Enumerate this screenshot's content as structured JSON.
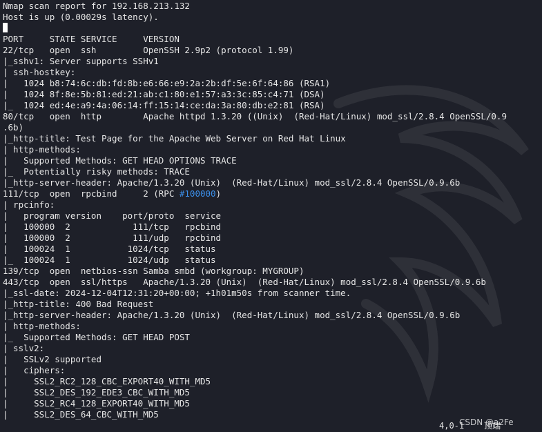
{
  "terminal": {
    "lines": [
      "Nmap scan report for 192.168.213.132",
      "Host is up (0.00029s latency).",
      "",
      "PORT     STATE SERVICE     VERSION",
      "22/tcp   open  ssh         OpenSSH 2.9p2 (protocol 1.99)",
      "|_sshv1: Server supports SSHv1",
      "| ssh-hostkey:",
      "|   1024 b8:74:6c:db:fd:8b:e6:66:e9:2a:2b:df:5e:6f:64:86 (RSA1)",
      "|   1024 8f:8e:5b:81:ed:21:ab:c1:80:e1:57:a3:3c:85:c4:71 (DSA)",
      "|_  1024 ed:4e:a9:4a:06:14:ff:15:14:ce:da:3a:80:db:e2:81 (RSA)",
      "80/tcp   open  http        Apache httpd 1.3.20 ((Unix)  (Red-Hat/Linux) mod_ssl/2.8.4 OpenSSL/0.9",
      ".6b)",
      "|_http-title: Test Page for the Apache Web Server on Red Hat Linux",
      "| http-methods:",
      "|   Supported Methods: GET HEAD OPTIONS TRACE",
      "|_  Potentially risky methods: TRACE",
      "|_http-server-header: Apache/1.3.20 (Unix)  (Red-Hat/Linux) mod_ssl/2.8.4 OpenSSL/0.9.6b",
      "111/tcp  open  rpcbind     2 (RPC ",
      "| rpcinfo:",
      "|   program version    port/proto  service",
      "|   100000  2            111/tcp   rpcbind",
      "|   100000  2            111/udp   rpcbind",
      "|   100024  1           1024/tcp   status",
      "|_  100024  1           1024/udp   status",
      "139/tcp  open  netbios-ssn Samba smbd (workgroup: MYGROUP)",
      "443/tcp  open  ssl/https   Apache/1.3.20 (Unix)  (Red-Hat/Linux) mod_ssl/2.8.4 OpenSSL/0.9.6b",
      "|_ssl-date: 2024-12-04T12:31:20+00:00; +1h01m50s from scanner time.",
      "|_http-title: 400 Bad Request",
      "|_http-server-header: Apache/1.3.20 (Unix)  (Red-Hat/Linux) mod_ssl/2.8.4 OpenSSL/0.9.6b",
      "| http-methods:",
      "|_  Supported Methods: GET HEAD POST",
      "| sslv2:",
      "|   SSLv2 supported",
      "|   ciphers:",
      "|     SSL2_RC2_128_CBC_EXPORT40_WITH_MD5",
      "|     SSL2_DES_192_EDE3_CBC_WITH_MD5",
      "|     SSL2_RC4_128_EXPORT40_WITH_MD5",
      "|     SSL2_DES_64_CBC_WITH_MD5"
    ],
    "rpc_number": "#100000",
    "rpc_suffix": ")"
  },
  "status_bar": {
    "position": "4,0-1",
    "scroll": "顶端"
  },
  "watermark": {
    "text": "CSDN @a2Fe"
  },
  "colors": {
    "background": "#1e2029",
    "foreground": "#e6e6e6",
    "accent": "#3b8ee8"
  }
}
